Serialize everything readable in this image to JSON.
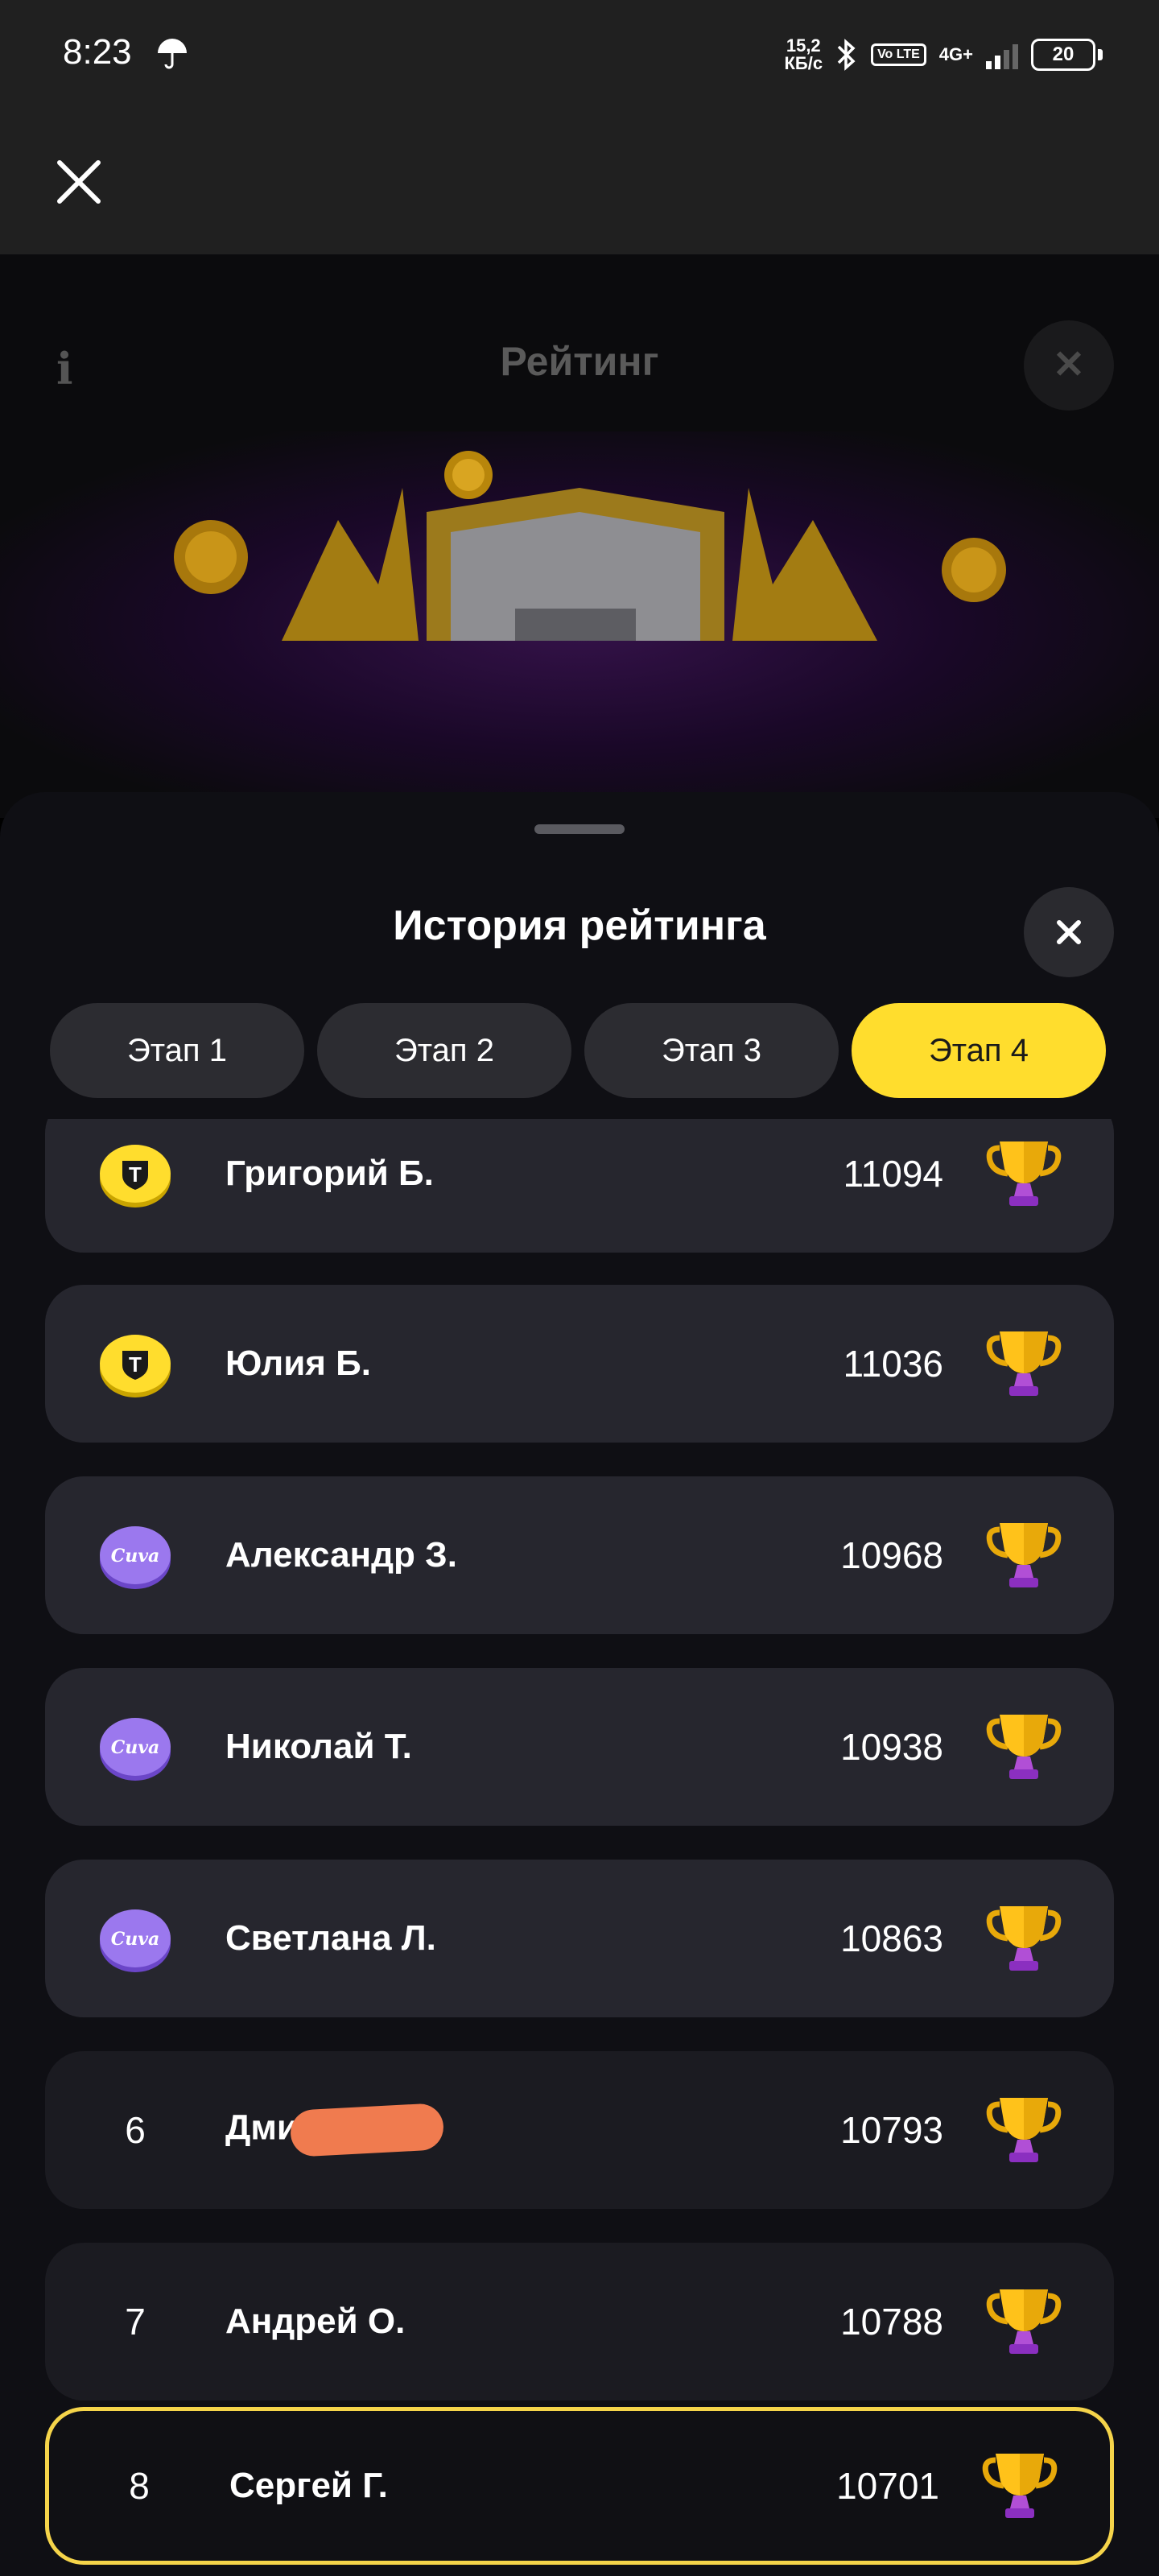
{
  "status_bar": {
    "time": "8:23",
    "speed_value": "15,2",
    "speed_unit": "КБ/с",
    "network": "4G+",
    "volte": "Vo LTE",
    "battery": "20"
  },
  "background_screen": {
    "title": "Рейтинг"
  },
  "sheet": {
    "title": "История рейтинга",
    "tabs": [
      {
        "label": "Этап 1",
        "active": false
      },
      {
        "label": "Этап 2",
        "active": false
      },
      {
        "label": "Этап 3",
        "active": false
      },
      {
        "label": "Этап 4",
        "active": true
      }
    ],
    "entries": [
      {
        "rank": "",
        "badge": "tbank-coin-icon",
        "name": "Григорий Б.",
        "score": "11094"
      },
      {
        "rank": "",
        "badge": "tbank-coin-icon",
        "name": "Юлия Б.",
        "score": "11036"
      },
      {
        "rank": "",
        "badge": "cuva-coin-icon",
        "name": "Александр З.",
        "score": "10968"
      },
      {
        "rank": "",
        "badge": "cuva-coin-icon",
        "name": "Николай Т.",
        "score": "10938"
      },
      {
        "rank": "",
        "badge": "cuva-coin-icon",
        "name": "Светлана Л.",
        "score": "10863"
      },
      {
        "rank": "6",
        "badge": "",
        "name": "Дми",
        "score": "10793"
      },
      {
        "rank": "7",
        "badge": "",
        "name": "Андрей О.",
        "score": "10788"
      },
      {
        "rank": "8",
        "badge": "",
        "name": "Сергей Г.",
        "score": "10701",
        "current_user": true
      }
    ]
  },
  "colors": {
    "accent": "#ffdd2d",
    "row_bg": "#26262e",
    "sheet_bg": "#0f0f14",
    "highlight_border": "#f5d44a"
  }
}
